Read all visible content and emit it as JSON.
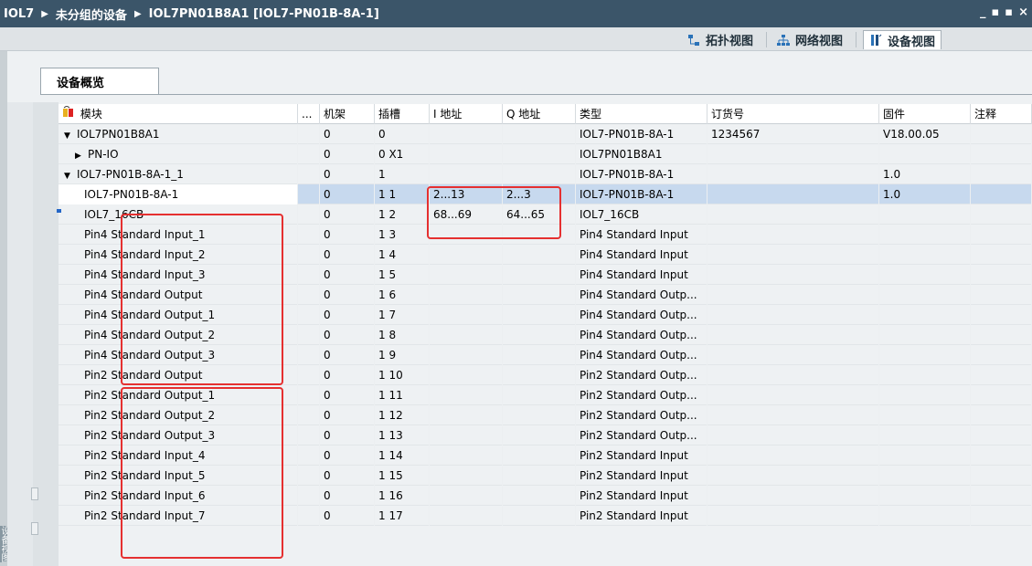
{
  "breadcrumb": [
    "IOL7",
    "未分组的设备",
    "IOL7PN01B8A1 [IOL7-PN01B-8A-1]"
  ],
  "window_controls": [
    "_",
    "▪",
    "▪",
    "×"
  ],
  "views": [
    {
      "label": "拓扑视图",
      "icon": "topology-icon",
      "active": false
    },
    {
      "label": "网络视图",
      "icon": "network-icon",
      "active": false
    },
    {
      "label": "设备视图",
      "icon": "device-icon",
      "active": true
    }
  ],
  "side_label": "设备视图",
  "tab": {
    "label": "设备概览"
  },
  "columns": [
    "模块",
    "...",
    "机架",
    "插槽",
    "I 地址",
    "Q 地址",
    "类型",
    "订货号",
    "固件",
    "注释"
  ],
  "rows": [
    {
      "indent": 0,
      "expander": "▼",
      "name": "IOL7PN01B8A1",
      "rack": "0",
      "slot": "0",
      "i": "",
      "q": "",
      "type": "IOL7-PN01B-8A-1",
      "order": "1234567",
      "fw": "V18.00.05"
    },
    {
      "indent": 1,
      "expander": "▶",
      "name": "PN-IO",
      "rack": "0",
      "slot": "0 X1",
      "i": "",
      "q": "",
      "type": "IOL7PN01B8A1",
      "order": "",
      "fw": ""
    },
    {
      "indent": 0,
      "expander": "▼",
      "name": "IOL7-PN01B-8A-1_1",
      "rack": "0",
      "slot": "1",
      "i": "",
      "q": "",
      "type": "IOL7-PN01B-8A-1",
      "order": "",
      "fw": "1.0"
    },
    {
      "indent": 2,
      "expander": "",
      "name": "IOL7-PN01B-8A-1",
      "rack": "0",
      "slot": "1 1",
      "i": "2...13",
      "q": "2...3",
      "type": "IOL7-PN01B-8A-1",
      "order": "",
      "fw": "1.0",
      "selected": true
    },
    {
      "indent": 2,
      "expander": "",
      "name": "IOL7_16CB",
      "rack": "0",
      "slot": "1 2",
      "i": "68...69",
      "q": "64...65",
      "type": "IOL7_16CB",
      "order": "",
      "fw": ""
    },
    {
      "indent": 2,
      "expander": "",
      "name": "Pin4 Standard Input_1",
      "rack": "0",
      "slot": "1 3",
      "i": "",
      "q": "",
      "type": "Pin4 Standard Input",
      "order": "",
      "fw": ""
    },
    {
      "indent": 2,
      "expander": "",
      "name": "Pin4 Standard Input_2",
      "rack": "0",
      "slot": "1 4",
      "i": "",
      "q": "",
      "type": "Pin4 Standard Input",
      "order": "",
      "fw": ""
    },
    {
      "indent": 2,
      "expander": "",
      "name": "Pin4 Standard Input_3",
      "rack": "0",
      "slot": "1 5",
      "i": "",
      "q": "",
      "type": "Pin4 Standard Input",
      "order": "",
      "fw": ""
    },
    {
      "indent": 2,
      "expander": "",
      "name": "Pin4 Standard Output",
      "rack": "0",
      "slot": "1 6",
      "i": "",
      "q": "",
      "type": "Pin4 Standard Outp...",
      "order": "",
      "fw": ""
    },
    {
      "indent": 2,
      "expander": "",
      "name": "Pin4 Standard Output_1",
      "rack": "0",
      "slot": "1 7",
      "i": "",
      "q": "",
      "type": "Pin4 Standard Outp...",
      "order": "",
      "fw": ""
    },
    {
      "indent": 2,
      "expander": "",
      "name": "Pin4 Standard Output_2",
      "rack": "0",
      "slot": "1 8",
      "i": "",
      "q": "",
      "type": "Pin4 Standard Outp...",
      "order": "",
      "fw": ""
    },
    {
      "indent": 2,
      "expander": "",
      "name": "Pin4 Standard Output_3",
      "rack": "0",
      "slot": "1 9",
      "i": "",
      "q": "",
      "type": "Pin4 Standard Outp...",
      "order": "",
      "fw": ""
    },
    {
      "indent": 2,
      "expander": "",
      "name": "Pin2 Standard Output",
      "rack": "0",
      "slot": "1 10",
      "i": "",
      "q": "",
      "type": "Pin2 Standard Outp...",
      "order": "",
      "fw": ""
    },
    {
      "indent": 2,
      "expander": "",
      "name": "Pin2 Standard Output_1",
      "rack": "0",
      "slot": "1 11",
      "i": "",
      "q": "",
      "type": "Pin2 Standard Outp...",
      "order": "",
      "fw": ""
    },
    {
      "indent": 2,
      "expander": "",
      "name": "Pin2 Standard Output_2",
      "rack": "0",
      "slot": "1 12",
      "i": "",
      "q": "",
      "type": "Pin2 Standard Outp...",
      "order": "",
      "fw": ""
    },
    {
      "indent": 2,
      "expander": "",
      "name": "Pin2 Standard Output_3",
      "rack": "0",
      "slot": "1 13",
      "i": "",
      "q": "",
      "type": "Pin2 Standard Outp...",
      "order": "",
      "fw": ""
    },
    {
      "indent": 2,
      "expander": "",
      "name": "Pin2 Standard Input_4",
      "rack": "0",
      "slot": "1 14",
      "i": "",
      "q": "",
      "type": "Pin2 Standard Input",
      "order": "",
      "fw": ""
    },
    {
      "indent": 2,
      "expander": "",
      "name": "Pin2 Standard Input_5",
      "rack": "0",
      "slot": "1 15",
      "i": "",
      "q": "",
      "type": "Pin2 Standard Input",
      "order": "",
      "fw": ""
    },
    {
      "indent": 2,
      "expander": "",
      "name": "Pin2 Standard Input_6",
      "rack": "0",
      "slot": "1 16",
      "i": "",
      "q": "",
      "type": "Pin2 Standard Input",
      "order": "",
      "fw": ""
    },
    {
      "indent": 2,
      "expander": "",
      "name": "Pin2 Standard Input_7",
      "rack": "0",
      "slot": "1 17",
      "i": "",
      "q": "",
      "type": "Pin2 Standard Input",
      "order": "",
      "fw": ""
    }
  ],
  "colors": {
    "titlebar": "#3b5569",
    "selection": "#c7d9ee",
    "highlight_box": "#e53030"
  }
}
